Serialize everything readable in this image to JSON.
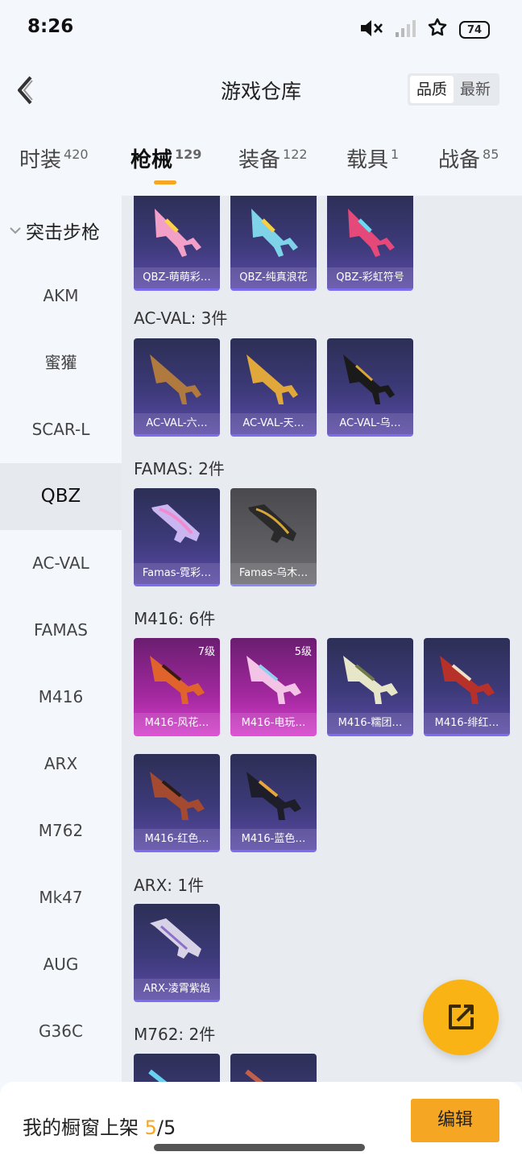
{
  "status": {
    "time": "8:26",
    "battery": "74"
  },
  "header": {
    "title": "游戏仓库",
    "sort": [
      "品质",
      "最新"
    ]
  },
  "tabs": [
    {
      "label": "时装",
      "count": "420"
    },
    {
      "label": "枪械",
      "count": "129"
    },
    {
      "label": "装备",
      "count": "122"
    },
    {
      "label": "载具",
      "count": "1"
    },
    {
      "label": "战备",
      "count": "85"
    }
  ],
  "sidebar": {
    "group": "突击步枪",
    "items": [
      "AKM",
      "蜜獾",
      "SCAR-L",
      "QBZ",
      "AC-VAL",
      "FAMAS",
      "M416",
      "ARX",
      "M762",
      "Mk47",
      "AUG",
      "G36C"
    ]
  },
  "sections": [
    {
      "title": "",
      "cards": [
        {
          "label": "QBZ-萌萌彩…",
          "level": ""
        },
        {
          "label": "QBZ-纯真浪花",
          "level": ""
        },
        {
          "label": "QBZ-彩虹符号",
          "level": ""
        }
      ]
    },
    {
      "title": "AC-VAL: 3件",
      "cards": [
        {
          "label": "AC-VAL-六…",
          "level": ""
        },
        {
          "label": "AC-VAL-天…",
          "level": ""
        },
        {
          "label": "AC-VAL-乌…",
          "level": ""
        }
      ]
    },
    {
      "title": "FAMAS: 2件",
      "cards": [
        {
          "label": "Famas-霓彩…",
          "level": ""
        },
        {
          "label": "Famas-乌木…",
          "level": ""
        }
      ]
    },
    {
      "title": "M416: 6件",
      "cards": [
        {
          "label": "M416-风花…",
          "level": "7级"
        },
        {
          "label": "M416-电玩…",
          "level": "5级"
        },
        {
          "label": "M416-糯团…",
          "level": ""
        },
        {
          "label": "M416-绯红…",
          "level": ""
        },
        {
          "label": "M416-红色…",
          "level": ""
        },
        {
          "label": "M416-蓝色…",
          "level": ""
        }
      ]
    },
    {
      "title": "ARX: 1件",
      "cards": [
        {
          "label": "ARX-凌霄紫焰",
          "level": ""
        }
      ]
    },
    {
      "title": "M762: 2件",
      "cards": []
    }
  ],
  "footer": {
    "label": "我的橱窗上架 ",
    "current": "5",
    "total": "/5",
    "edit": "编辑"
  }
}
